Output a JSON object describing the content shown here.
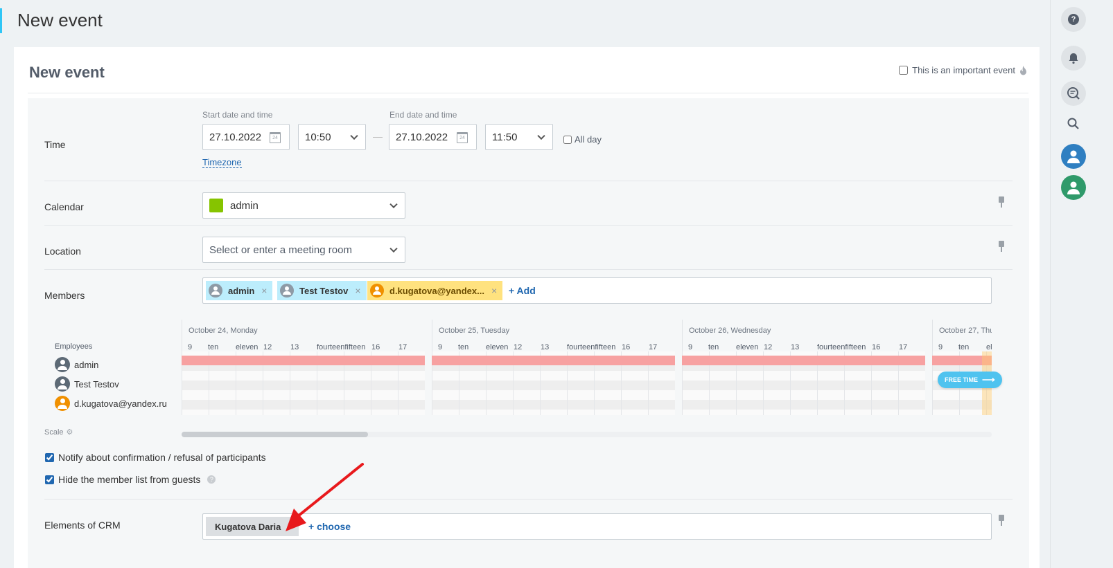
{
  "page": {
    "title": "New event"
  },
  "card": {
    "title": "New event",
    "important_label": "This is an important event"
  },
  "time": {
    "label": "Time",
    "start_caption": "Start date and time",
    "end_caption": "End date and time",
    "start_date": "27.10.2022",
    "start_time": "10:50",
    "end_date": "27.10.2022",
    "end_time": "11:50",
    "dash": "—",
    "all_day_label": "All day",
    "all_day_checked": false,
    "timezone_link": "Timezone",
    "calendar_icon_text": "24"
  },
  "calendar": {
    "label": "Calendar",
    "value": "admin",
    "color": "#86c400"
  },
  "location": {
    "label": "Location",
    "placeholder": "Select or enter a meeting room"
  },
  "members": {
    "label": "Members",
    "tags": [
      {
        "name": "admin",
        "style": "blue"
      },
      {
        "name": "Test Testov",
        "style": "blue"
      },
      {
        "name": "d.kugatova@yandex...",
        "style": "yellow"
      }
    ],
    "remove_glyph": "×",
    "add_label": "+ Add"
  },
  "planner": {
    "employees_caption": "Employees",
    "days": [
      {
        "label": "October 24, Monday"
      },
      {
        "label": "October 25, Tuesday"
      },
      {
        "label": "October 26, Wednesday"
      },
      {
        "label": "October 27, Thu"
      }
    ],
    "hours": [
      "9",
      "ten",
      "eleven",
      "12",
      "13",
      "fourteenfifteen",
      "16",
      "17"
    ],
    "hours_partial": [
      "9",
      "ten",
      "el"
    ],
    "employees": [
      {
        "name": "admin",
        "avatar": "grey"
      },
      {
        "name": "Test Testov",
        "avatar": "grey"
      },
      {
        "name": "d.kugatova@yandex.ru",
        "avatar": "orange"
      }
    ],
    "free_time_label": "FREE TIME",
    "free_time_arrow": "⟶",
    "scale_label": "Scale",
    "gear_glyph": "⚙",
    "scroll_position": 0.23
  },
  "options": {
    "notify_label": "Notify about confirmation / refusal of participants",
    "notify_checked": true,
    "hide_members_label": "Hide the member list from guests",
    "hide_members_checked": true,
    "help_glyph": "?"
  },
  "crm": {
    "label": "Elements of CRM",
    "tag": "Kugatova Daria",
    "remove_glyph": "×",
    "choose_label": "+ choose"
  },
  "rail": {
    "help_glyph": "?"
  },
  "colors": {
    "accent": "#2fc6f6",
    "link": "#2067b0",
    "busy": "#f7a1a1",
    "free_time": "#4fc3ef",
    "annotation": "#e8191c"
  }
}
